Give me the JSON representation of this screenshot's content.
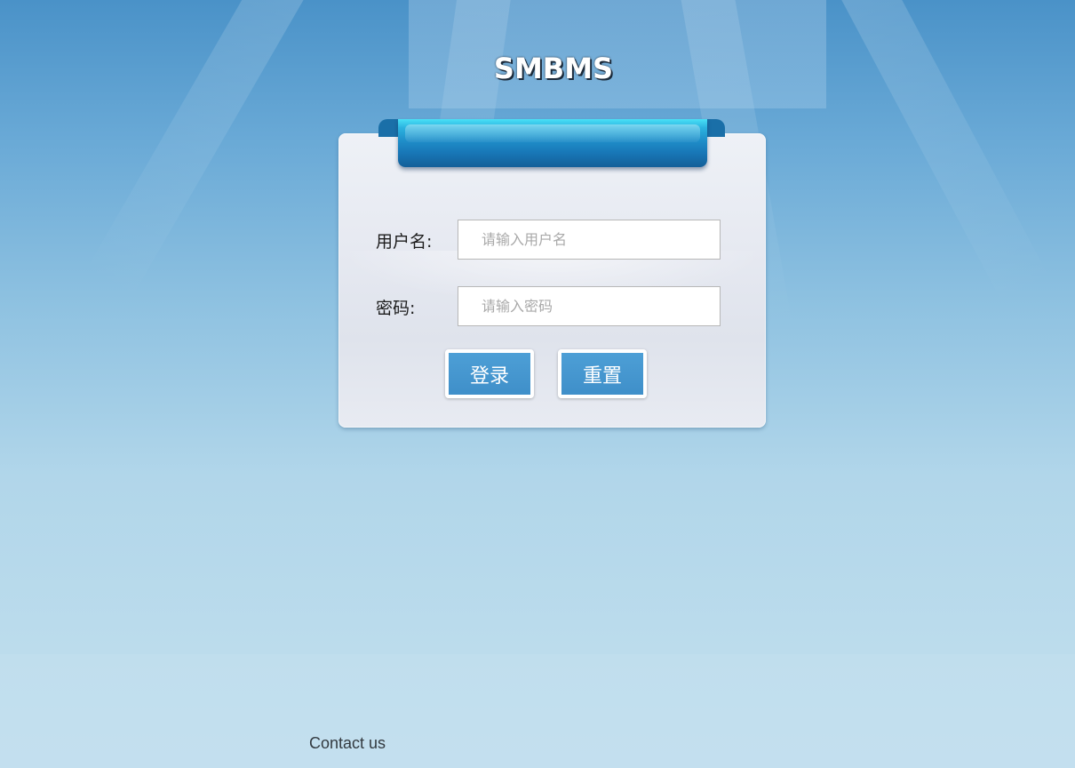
{
  "app": {
    "title": "SMBMS"
  },
  "login_form": {
    "username_label": "用户名:",
    "username_placeholder": "请输入用户名",
    "username_value": "",
    "password_label": "密码:",
    "password_placeholder": "请输入密码",
    "password_value": "",
    "login_button": "登录",
    "reset_button": "重置"
  },
  "footer": {
    "contact_link": "Contact us"
  },
  "colors": {
    "background_top": "#4a92c8",
    "background_bottom": "#c1deee",
    "ribbon": "#1f8ec9",
    "button": "#4d9fd6"
  }
}
